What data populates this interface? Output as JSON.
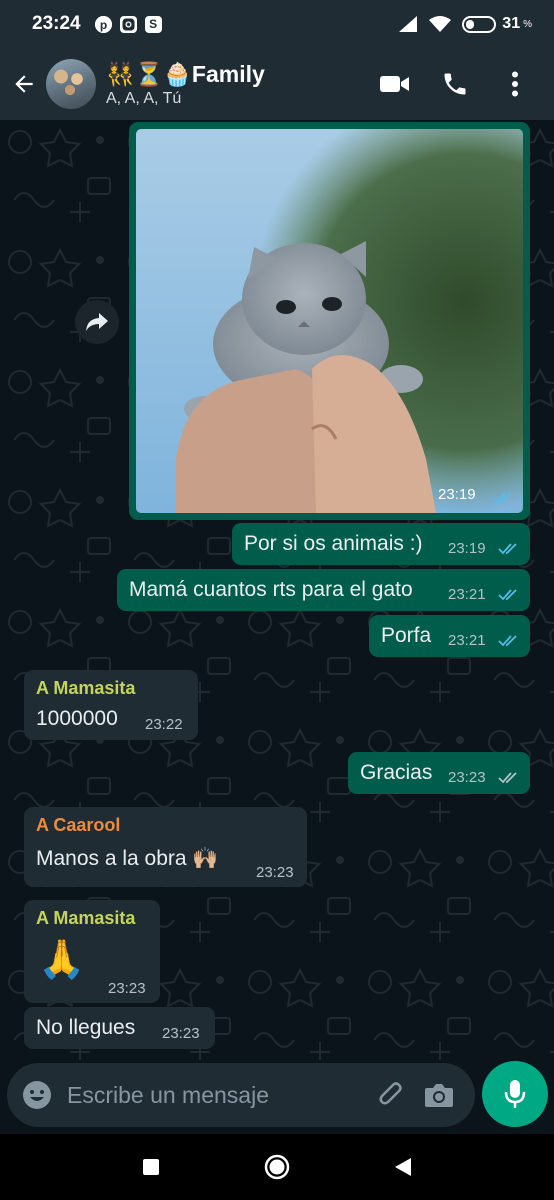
{
  "status_bar": {
    "time": "23:24",
    "battery": "31",
    "battery_level": 0.31,
    "apps": [
      "pinterest-icon",
      "instagram-icon",
      "s-app-icon"
    ],
    "s_app_letter": "S"
  },
  "header": {
    "title_emoji": "👯⏳🧁",
    "title": "Family",
    "subtitle": "A, A, A, Tú"
  },
  "messages": {
    "photo_time": "23:19",
    "m1": {
      "text": "Por si os animais :)",
      "time": "23:19"
    },
    "m2": {
      "text": "Mamá cuantos rts para el gato",
      "time": "23:21"
    },
    "m3": {
      "text": "Porfa",
      "time": "23:21"
    },
    "m4": {
      "sender": "A Mamasita",
      "text": "1000000",
      "time": "23:22"
    },
    "m5": {
      "text": "Gracias",
      "time": "23:23"
    },
    "m6": {
      "sender": "A Caarool",
      "text": "Manos a la obra 🙌🏼",
      "time": "23:23"
    },
    "m7": {
      "sender": "A Mamasita",
      "text": "🙏",
      "time": "23:23"
    },
    "m8": {
      "text": "No llegues",
      "time": "23:23"
    }
  },
  "composer": {
    "placeholder": "Escribe un mensaje"
  },
  "colors": {
    "outgoing": "#005c4b",
    "incoming": "#1f2c34",
    "read_tick": "#53bdeb",
    "sent_tick": "#b4c2c9",
    "sender_mamasita": "#c4d45c",
    "sender_caarool": "#f08a3c",
    "accent": "#00a884"
  }
}
